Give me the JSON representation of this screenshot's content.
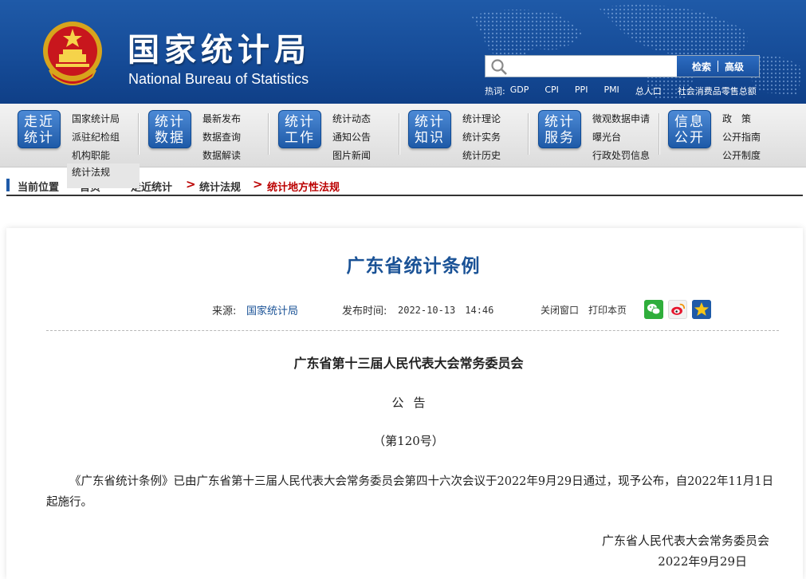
{
  "header": {
    "title_cn": "国家统计局",
    "title_en": "National Bureau of Statistics",
    "search": {
      "placeholder": "",
      "search_label": "检索",
      "advanced_label": "高级"
    },
    "hotwords_label": "热词:",
    "hotwords": [
      "GDP",
      "CPI",
      "PPI",
      "PMI",
      "总人口",
      "社会消费品零售总额"
    ]
  },
  "nav": {
    "groups": [
      {
        "badge": [
          "走近",
          "统计"
        ],
        "links": [
          "国家统计局",
          "派驻纪检组",
          "机构职能"
        ]
      },
      {
        "badge": [
          "统计",
          "数据"
        ],
        "links": [
          "最新发布",
          "数据查询",
          "数据解读"
        ]
      },
      {
        "badge": [
          "统计",
          "工作"
        ],
        "links": [
          "统计动态",
          "通知公告",
          "图片新闻"
        ]
      },
      {
        "badge": [
          "统计",
          "知识"
        ],
        "links": [
          "统计理论",
          "统计实务",
          "统计历史"
        ]
      },
      {
        "badge": [
          "统计",
          "服务"
        ],
        "links": [
          "微观数据申请",
          "曝光台",
          "行政处罚信息"
        ]
      },
      {
        "badge": [
          "信息",
          "公开"
        ],
        "links": [
          "政　策",
          "公开指南",
          "公开制度"
        ]
      }
    ],
    "dropdown_item": "统计法规"
  },
  "breadcrumb": {
    "label": "当前位置",
    "items": [
      "首页",
      "走近统计",
      "统计法规",
      "统计地方性法规"
    ],
    "separator": ">"
  },
  "article": {
    "title": "广东省统计条例",
    "source_label": "来源:",
    "source": "国家统计局",
    "time_label": "发布时间:",
    "time": "2022-10-13　14:46",
    "close_label": "关闭窗口",
    "print_label": "打印本页",
    "org": "广东省第十三届人民代表大会常务委员会",
    "doc_type": "公告",
    "doc_number": "（第120号）",
    "body": "《广东省统计条例》已由广东省第十三届人民代表大会常务委员会第四十六次会议于2022年9月29日通过，现予公布，自2022年11月1日起施行。",
    "sign_org": "广东省人民代表大会常务委员会",
    "sign_date": "2022年9月29日"
  },
  "colors": {
    "header_blue": "#1f5aa8",
    "title_blue": "#1a5296",
    "breadcrumb_red": "#bb0000"
  },
  "icons": {
    "search": "search-icon",
    "wechat": "wechat-icon",
    "weibo": "weibo-icon",
    "favorite": "star-icon",
    "emblem": "national-emblem-icon"
  }
}
